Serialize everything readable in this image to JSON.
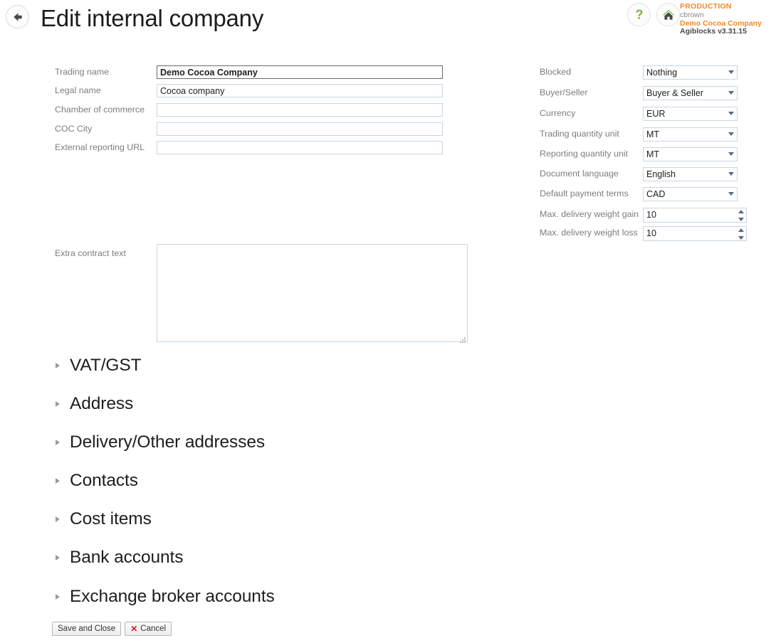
{
  "header": {
    "back_icon": "back-arrow-icon",
    "title": "Edit internal company",
    "help_icon": "question-mark-icon",
    "home_icon": "home-icon",
    "environment": "PRODUCTION",
    "user": "cbrown",
    "company": "Demo Cocoa Company",
    "version": "Agiblocks v3.31.15",
    "accent_color": "#f08a24"
  },
  "left_fields": [
    {
      "label": "Trading name",
      "value": "Demo Cocoa Company",
      "focused": true
    },
    {
      "label": "Legal name",
      "value": "Cocoa company",
      "focused": false
    },
    {
      "label": "Chamber of commerce",
      "value": "",
      "focused": false
    },
    {
      "label": "COC City",
      "value": "",
      "focused": false
    },
    {
      "label": "External reporting URL",
      "value": "",
      "focused": false
    }
  ],
  "extra_contract": {
    "label": "Extra contract text",
    "value": "",
    "placeholder": ""
  },
  "right_fields": [
    {
      "label": "Blocked",
      "value": "Nothing",
      "type": "select"
    },
    {
      "label": "Buyer/Seller",
      "value": "Buyer & Seller",
      "type": "select"
    },
    {
      "label": "Currency",
      "value": "EUR",
      "type": "select"
    },
    {
      "label": "Trading quantity unit",
      "value": "MT",
      "type": "select"
    },
    {
      "label": "Reporting quantity unit",
      "value": "MT",
      "type": "select"
    },
    {
      "label": "Document language",
      "value": "English",
      "type": "select"
    },
    {
      "label": "Default payment terms",
      "value": "CAD",
      "type": "select"
    },
    {
      "label": "Max. delivery weight gain",
      "value": "10",
      "type": "spinner"
    },
    {
      "label": "Max. delivery weight loss",
      "value": "10",
      "type": "spinner"
    }
  ],
  "sections": [
    {
      "label": "VAT/GST",
      "expanded": false
    },
    {
      "label": "Address",
      "expanded": false
    },
    {
      "label": "Delivery/Other addresses",
      "expanded": false
    },
    {
      "label": "Contacts",
      "expanded": false
    },
    {
      "label": "Cost items",
      "expanded": false
    },
    {
      "label": "Bank accounts",
      "expanded": false
    },
    {
      "label": "Exchange broker accounts",
      "expanded": false
    }
  ],
  "footer": {
    "save_label": "Save and Close",
    "cancel_label": "Cancel",
    "cancel_icon": "red-x-icon"
  }
}
